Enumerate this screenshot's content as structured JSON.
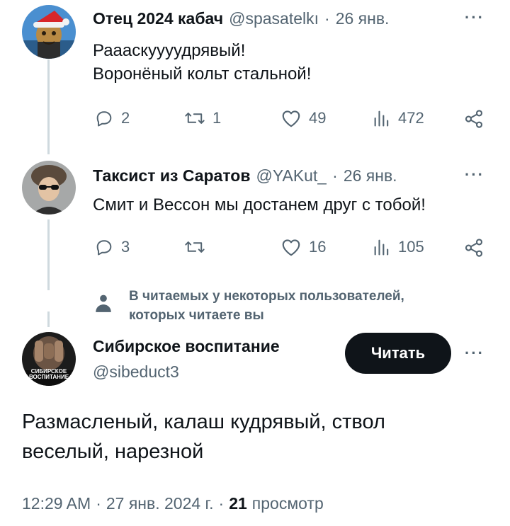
{
  "tweets": [
    {
      "author": "Отец 2024 кабач",
      "handle": "@spasatelkı",
      "separator": "·",
      "date": "26 янв.",
      "text_lines": [
        "Рааaскуууудрявый!",
        "Воронёный кольт стальной!"
      ],
      "actions": {
        "replies": "2",
        "retweets": "1",
        "likes": "49",
        "views": "472"
      }
    },
    {
      "author": "Таксист из Саратов",
      "handle": "@YAKut_",
      "separator": "·",
      "date": "26 янв.",
      "text_lines": [
        "Смит и Вессон мы достанем друг с тобой!"
      ],
      "actions": {
        "replies": "3",
        "retweets": "",
        "likes": "16",
        "views": "105"
      }
    }
  ],
  "followed_notice": {
    "line1": "В читаемых у некоторых пользователей,",
    "line2": "которых читаете вы"
  },
  "main_tweet": {
    "author": "Сибирское воспитание",
    "handle": "@sibeduct3",
    "follow_label": "Читать",
    "avatar_caption_1": "СИБИРСКОЕ",
    "avatar_caption_2": "ВОСПИТАНИЕ",
    "text_line1": "Размасленый, калаш кудрявый, ствол",
    "text_line2": "веселый, нарезной",
    "time": "12:29 AM",
    "date": "27 янв. 2024 г.",
    "separator": "·",
    "views_count": "21",
    "views_label": "просмотр"
  },
  "more_label": "···",
  "colors": {
    "text": "#0f1419",
    "secondary": "#536471",
    "line": "#cfd9de",
    "button": "#0f1419"
  }
}
